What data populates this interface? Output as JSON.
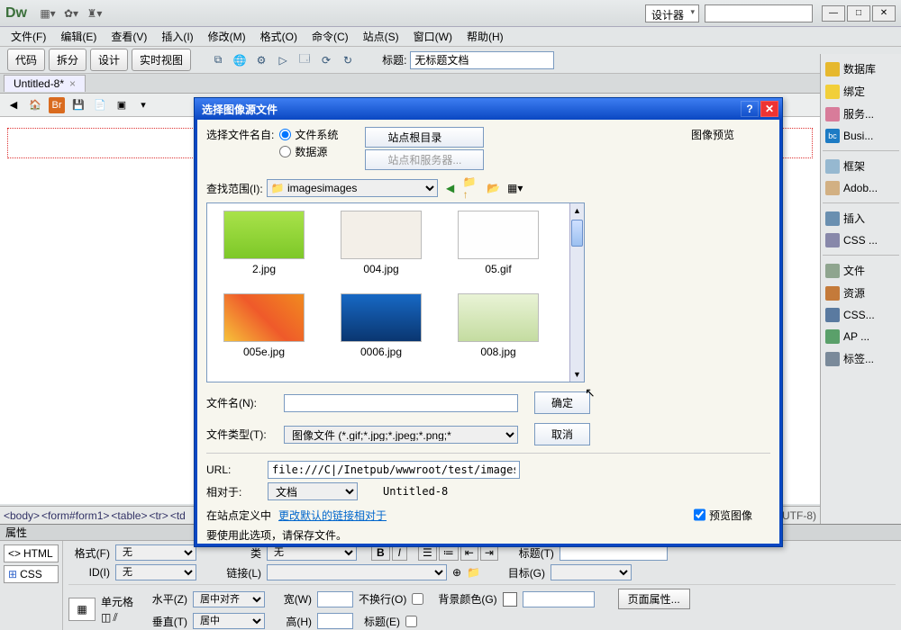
{
  "app": {
    "logo": "Dw",
    "role_label": "设计器"
  },
  "window_controls": {
    "min": "—",
    "max": "□",
    "close": "✕"
  },
  "menubar": [
    "文件(F)",
    "编辑(E)",
    "查看(V)",
    "插入(I)",
    "修改(M)",
    "格式(O)",
    "命令(C)",
    "站点(S)",
    "窗口(W)",
    "帮助(H)"
  ],
  "toolbar1": {
    "buttons": [
      "代码",
      "拆分",
      "设计",
      "实时视图"
    ],
    "title_label": "标题:",
    "title_value": "无标题文档"
  },
  "doc_tab": {
    "name": "Untitled-8*",
    "close": "×"
  },
  "right_panel": [
    {
      "icon": "db",
      "label": "数据库"
    },
    {
      "icon": "bolt",
      "label": "绑定"
    },
    {
      "icon": "srv",
      "label": "服务..."
    },
    {
      "icon": "bc",
      "label": "Busi..."
    },
    {
      "sep": true
    },
    {
      "icon": "frame",
      "label": "框架"
    },
    {
      "icon": "adb",
      "label": "Adob..."
    },
    {
      "sep": true
    },
    {
      "icon": "ins",
      "label": "插入"
    },
    {
      "icon": "css",
      "label": "CSS ..."
    },
    {
      "sep": true
    },
    {
      "icon": "file",
      "label": "文件"
    },
    {
      "icon": "res",
      "label": "资源"
    },
    {
      "icon": "css2",
      "label": "CSS..."
    },
    {
      "icon": "ap",
      "label": "AP ..."
    },
    {
      "icon": "tag",
      "label": "标签..."
    }
  ],
  "tagpath": [
    "<body>",
    "<form#form1>",
    "<table>",
    "<tr>",
    "<td"
  ],
  "encoding": "(UTF-8)",
  "props": {
    "title": "属性",
    "modes": {
      "html": "HTML",
      "css": "CSS"
    },
    "format_label": "格式(F)",
    "format_value": "无",
    "id_label": "ID(I)",
    "id_value": "无",
    "class_label": "类",
    "class_value": "无",
    "link_label": "链接(L)",
    "btitle_label": "标题(T)",
    "target_label": "目标(G)",
    "cell_label": "单元格",
    "horiz_label": "水平(Z)",
    "horiz_value": "居中对齐",
    "vert_label": "垂直(T)",
    "vert_value": "居中",
    "width_label": "宽(W)",
    "height_label": "高(H)",
    "nowrap_label": "不换行(O)",
    "header_label": "标题(E)",
    "bgcolor_label": "背景颜色(G)",
    "pageprops_btn": "页面属性..."
  },
  "dialog": {
    "title": "选择图像源文件",
    "help": "?",
    "close": "✕",
    "select_from_label": "选择文件名自:",
    "radio_fs": "文件系统",
    "radio_ds": "数据源",
    "site_root_btn": "站点根目录",
    "site_servers_btn": "站点和服务器...",
    "preview_label": "图像预览",
    "lookin_label": "查找范围(I):",
    "lookin_value": "images",
    "files": [
      {
        "name": "2.jpg",
        "bg": "linear-gradient(#a9e24a,#7dc828)"
      },
      {
        "name": "004.jpg",
        "bg": "#f3efe8"
      },
      {
        "name": "05.gif",
        "bg": "#fefefe"
      },
      {
        "name": "005e.jpg",
        "bg": "linear-gradient(45deg,#f6c23a,#ef5a2a,#f08a1f)"
      },
      {
        "name": "0006.jpg",
        "bg": "linear-gradient(#1768c4,#0a3670)"
      },
      {
        "name": "008.jpg",
        "bg": "linear-gradient(#e9f3d6,#c4dca0)"
      }
    ],
    "filename_label": "文件名(N):",
    "filetype_label": "文件类型(T):",
    "filetype_value": "图像文件 (*.gif;*.jpg;*.jpeg;*.png;*",
    "ok_btn": "确定",
    "cancel_btn": "取消",
    "url_label": "URL:",
    "url_value": "file:///C|/Inetpub/wwwroot/test/images/",
    "rel_label": "相对于:",
    "rel_value": "文档",
    "rel_doc": "Untitled-8",
    "note_prefix": "在站点定义中",
    "note_link": "更改默认的链接相对于",
    "note_suffix": "要使用此选项，请保存文件。",
    "preview_chk": "预览图像"
  }
}
